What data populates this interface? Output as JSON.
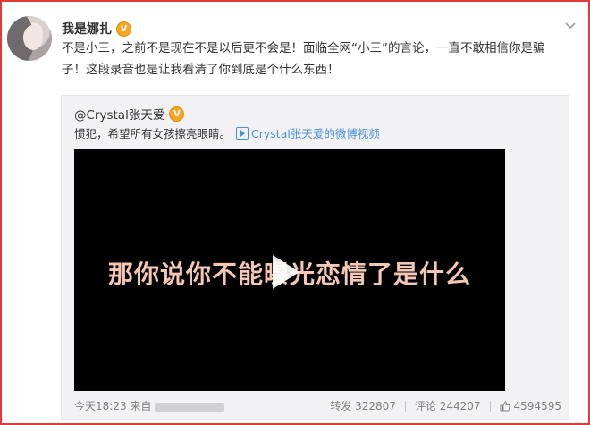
{
  "post": {
    "author": "我是娜扎",
    "verified_badge": "V",
    "text_line1": "不是小三，之前不是现在不是以后更不会是！面临全网“小三”的言论，一直不敢相信你是骗",
    "text_line2": "子！这段录音也是让我看清了你到底是个什么东西！"
  },
  "repost": {
    "author": "@Crystal张天爱",
    "text": "惯犯，希望所有女孩擦亮眼睛。",
    "video_link": "Crystal张天爱的微博视频",
    "video_subtitle": "那你说你不能曝光恋情了是什么",
    "time": "今天18:23 来自",
    "reposts_label": "转发",
    "reposts": "322807",
    "comments_label": "评论",
    "comments": "244207",
    "likes": "4594595"
  },
  "colors": {
    "frame": "#e53935",
    "link": "#4a90d9",
    "badge": "#f5a623"
  },
  "icons": [
    "verified-badge-icon",
    "chevron-down-icon",
    "video-play-icon",
    "thumbs-up-icon"
  ]
}
